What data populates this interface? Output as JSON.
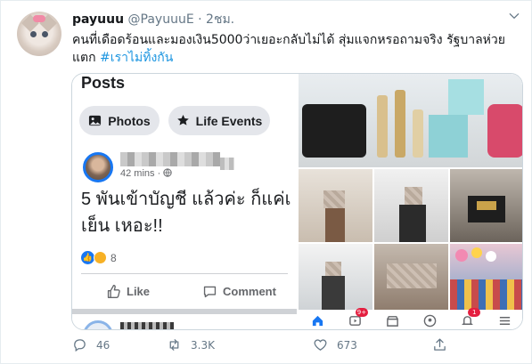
{
  "tweet": {
    "display_name": "payuuu",
    "handle": "@PayuuuE",
    "separator": "·",
    "time": "2ชม.",
    "text_line1": "คนที่เดือดร้อนและมองเงิน5000ว่าเยอะกลับไม่ได้ สุ่มแจกหรอถามจริง รัฐบาลห่วย",
    "text_line2_prefix": "แตก ",
    "hashtag": "#เราไม่ทิ้งกัน"
  },
  "fb_post": {
    "section_title": "Posts",
    "photos_label": "Photos",
    "events_label": "Life Events",
    "meta_time": "42 mins",
    "meta_sep": "·",
    "body_line1": "5 พันเข้าบัญชี แล้วค่ะ ก็แค่เ",
    "body_line2": "เย็น เหอะ!!",
    "reaction_count": "8",
    "like_label": "Like",
    "comment_label": "Comment"
  },
  "ig": {
    "notif_badge": "9+",
    "msg_badge": "1"
  },
  "actions": {
    "replies": "46",
    "retweets": "3.3K",
    "likes": "673"
  },
  "colors": {
    "link_blue": "#1b95e0",
    "fb_blue": "#1877f2",
    "muted": "#657786"
  }
}
